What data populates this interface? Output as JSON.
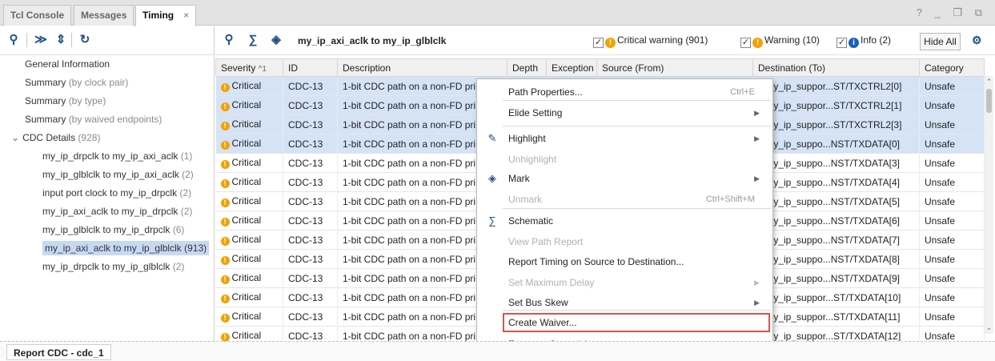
{
  "tabs": [
    {
      "label": "Tcl Console"
    },
    {
      "label": "Messages"
    },
    {
      "label": "Timing"
    }
  ],
  "window_controls": "? _ ❐ ⧉",
  "left_tree": {
    "items": [
      {
        "label": "General Information",
        "count": ""
      },
      {
        "label": "Summary",
        "count": "(by clock pair)"
      },
      {
        "label": "Summary",
        "count": "(by type)"
      },
      {
        "label": "Summary",
        "count": "(by waived endpoints)"
      },
      {
        "label": "CDC Details",
        "count": "(928)"
      },
      {
        "label": "my_ip_drpclk to my_ip_axi_aclk",
        "count": "(1)"
      },
      {
        "label": "my_ip_glblclk to my_ip_axi_aclk",
        "count": "(2)"
      },
      {
        "label": "input port clock to my_ip_drpclk",
        "count": "(2)"
      },
      {
        "label": "my_ip_axi_aclk to my_ip_drpclk",
        "count": "(2)"
      },
      {
        "label": "my_ip_glblclk to my_ip_drpclk",
        "count": "(6)"
      },
      {
        "label": "my_ip_axi_aclk to my_ip_glblclk",
        "count": "(913)"
      },
      {
        "label": "my_ip_drpclk to my_ip_glblclk",
        "count": "(2)"
      }
    ]
  },
  "right_toolbar": {
    "title": "my_ip_axi_aclk to my_ip_glblclk",
    "filters": [
      {
        "label": "Critical warning (901)",
        "checked": true,
        "color": "#f2a100"
      },
      {
        "label": "Warning (10)",
        "checked": true,
        "color": "#f2a100"
      },
      {
        "label": "Info (2)",
        "checked": true,
        "color": "#1a5fb4"
      }
    ],
    "hide_all": "Hide All"
  },
  "table": {
    "columns": [
      "Severity",
      "ID",
      "Description",
      "Depth",
      "Exception",
      "Source (From)",
      "Destination (To)",
      "Category"
    ],
    "sort_indicator": "^1",
    "rows": [
      {
        "severity": "Critical",
        "id": "CDC-13",
        "desc": "1-bit CDC path on a non-FD pri",
        "dest": "i_my_ip_suppor...ST/TXCTRL2[0]",
        "cat": "Unsafe",
        "selected": true
      },
      {
        "severity": "Critical",
        "id": "CDC-13",
        "desc": "1-bit CDC path on a non-FD pri",
        "dest": "i_my_ip_suppor...ST/TXCTRL2[1]",
        "cat": "Unsafe",
        "selected": true
      },
      {
        "severity": "Critical",
        "id": "CDC-13",
        "desc": "1-bit CDC path on a non-FD pri",
        "dest": "i_my_ip_suppor...ST/TXCTRL2[3]",
        "cat": "Unsafe",
        "selected": true
      },
      {
        "severity": "Critical",
        "id": "CDC-13",
        "desc": "1-bit CDC path on a non-FD pri",
        "dest": "i_my_ip_suppo...NST/TXDATA[0]",
        "cat": "Unsafe",
        "selected": true
      },
      {
        "severity": "Critical",
        "id": "CDC-13",
        "desc": "1-bit CDC path on a non-FD pri",
        "dest": "i_my_ip_suppo...NST/TXDATA[3]",
        "cat": "Unsafe",
        "selected": false
      },
      {
        "severity": "Critical",
        "id": "CDC-13",
        "desc": "1-bit CDC path on a non-FD pri",
        "dest": "i_my_ip_suppo...NST/TXDATA[4]",
        "cat": "Unsafe",
        "selected": false
      },
      {
        "severity": "Critical",
        "id": "CDC-13",
        "desc": "1-bit CDC path on a non-FD pri",
        "dest": "i_my_ip_suppo...NST/TXDATA[5]",
        "cat": "Unsafe",
        "selected": false
      },
      {
        "severity": "Critical",
        "id": "CDC-13",
        "desc": "1-bit CDC path on a non-FD pri",
        "dest": "i_my_ip_suppo...NST/TXDATA[6]",
        "cat": "Unsafe",
        "selected": false
      },
      {
        "severity": "Critical",
        "id": "CDC-13",
        "desc": "1-bit CDC path on a non-FD pri",
        "dest": "i_my_ip_suppo...NST/TXDATA[7]",
        "cat": "Unsafe",
        "selected": false
      },
      {
        "severity": "Critical",
        "id": "CDC-13",
        "desc": "1-bit CDC path on a non-FD pri",
        "dest": "i_my_ip_suppo...NST/TXDATA[8]",
        "cat": "Unsafe",
        "selected": false
      },
      {
        "severity": "Critical",
        "id": "CDC-13",
        "desc": "1-bit CDC path on a non-FD pri",
        "dest": "i_my_ip_suppo...NST/TXDATA[9]",
        "cat": "Unsafe",
        "selected": false
      },
      {
        "severity": "Critical",
        "id": "CDC-13",
        "desc": "1-bit CDC path on a non-FD pri",
        "dest": "i_my_ip_suppor...ST/TXDATA[10]",
        "cat": "Unsafe",
        "selected": false
      },
      {
        "severity": "Critical",
        "id": "CDC-13",
        "desc": "1-bit CDC path on a non-FD pri",
        "dest": "i_my_ip_suppor...ST/TXDATA[11]",
        "cat": "Unsafe",
        "selected": false
      },
      {
        "severity": "Critical",
        "id": "CDC-13",
        "desc": "1-bit CDC path on a non-FD pri",
        "dest": "i_my_ip_suppor...ST/TXDATA[12]",
        "cat": "Unsafe",
        "selected": false
      }
    ]
  },
  "context_menu": {
    "items": [
      {
        "label": "Path Properties...",
        "shortcut": "Ctrl+E",
        "disabled": false,
        "submenu": false,
        "icon": ""
      },
      {
        "label": "Elide Setting",
        "shortcut": "",
        "disabled": false,
        "submenu": true,
        "icon": ""
      },
      {
        "label": "Highlight",
        "shortcut": "",
        "disabled": false,
        "submenu": true,
        "icon": "highlight-icon"
      },
      {
        "label": "Unhighlight",
        "shortcut": "",
        "disabled": true,
        "submenu": false,
        "icon": ""
      },
      {
        "label": "Mark",
        "shortcut": "",
        "disabled": false,
        "submenu": true,
        "icon": "mark-icon"
      },
      {
        "label": "Unmark",
        "shortcut": "Ctrl+Shift+M",
        "disabled": true,
        "submenu": false,
        "icon": ""
      },
      {
        "label": "Schematic",
        "shortcut": "",
        "disabled": false,
        "submenu": false,
        "icon": "schematic-icon"
      },
      {
        "label": "View Path Report",
        "shortcut": "",
        "disabled": true,
        "submenu": false,
        "icon": ""
      },
      {
        "label": "Report Timing on Source to Destination...",
        "shortcut": "",
        "disabled": false,
        "submenu": false,
        "icon": ""
      },
      {
        "label": "Set Maximum Delay",
        "shortcut": "",
        "disabled": true,
        "submenu": true,
        "icon": ""
      },
      {
        "label": "Set Bus Skew",
        "shortcut": "",
        "disabled": false,
        "submenu": true,
        "icon": ""
      },
      {
        "label": "Create Waiver...",
        "shortcut": "",
        "disabled": false,
        "submenu": false,
        "icon": ""
      },
      {
        "label": "Export to Spreadsheet...",
        "shortcut": "",
        "disabled": false,
        "submenu": false,
        "icon": ""
      }
    ]
  },
  "bottom_tab": "Report CDC - cdc_1",
  "colors": {
    "accent": "#1f4e86",
    "warning": "#f2a100",
    "info": "#1a5fb4",
    "selection": "#d5e3f6",
    "focus_outline": "#d9534f"
  }
}
